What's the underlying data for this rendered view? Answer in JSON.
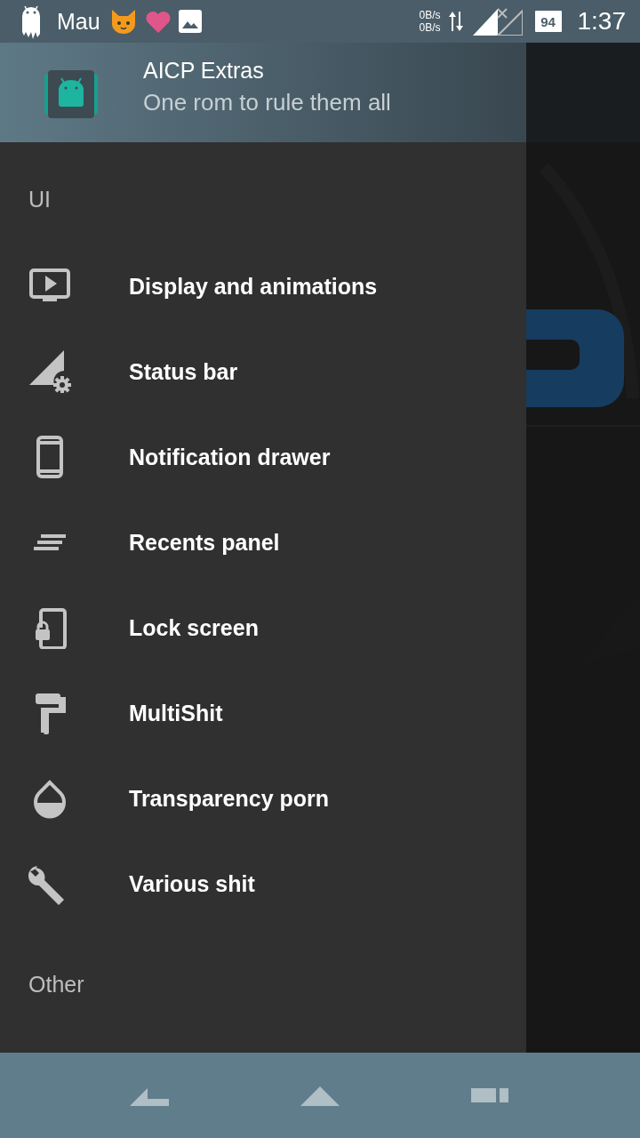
{
  "status_bar": {
    "carrier": "Mau",
    "upload_speed": "0B/s",
    "download_speed": "0B/s",
    "battery": "94",
    "time": "1:37"
  },
  "header": {
    "title": "AICP Extras",
    "subtitle": "One rom to rule them all"
  },
  "sections": [
    {
      "title": "UI",
      "items": [
        {
          "label": "Display and animations",
          "kind": "display"
        },
        {
          "label": "Status bar",
          "kind": "statusbar"
        },
        {
          "label": "Notification drawer",
          "kind": "phone"
        },
        {
          "label": "Recents panel",
          "kind": "lines"
        },
        {
          "label": "Lock screen",
          "kind": "lock"
        },
        {
          "label": "MultiShit",
          "kind": "roller"
        },
        {
          "label": "Transparency porn",
          "kind": "drop"
        },
        {
          "label": "Various shit",
          "kind": "wrench"
        }
      ]
    },
    {
      "title": "Other"
    }
  ]
}
